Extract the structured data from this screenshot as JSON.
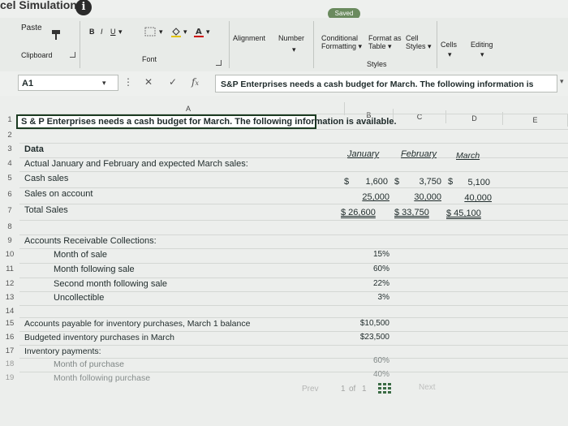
{
  "app": {
    "title": "cel Simulation",
    "saved": "Saved"
  },
  "ribbon": {
    "paste": "Paste",
    "font_buttons": [
      "B",
      "I",
      "U"
    ],
    "alignment": "Alignment",
    "number": "Number",
    "conditional_formatting_line1": "Conditional",
    "conditional_formatting_line2": "Formatting",
    "format_as_table_line1": "Format as",
    "format_as_table_line2": "Table",
    "cell_styles_line1": "Cell",
    "cell_styles_line2": "Styles",
    "cells": "Cells",
    "editing": "Editing",
    "groups": {
      "clipboard": "Clipboard",
      "font": "Font",
      "styles": "Styles"
    }
  },
  "formula_bar": {
    "cell_ref": "A1",
    "formula": "S&P Enterprises needs a cash budget for March. The following information is"
  },
  "columns": [
    "A",
    "B",
    "C",
    "D",
    "E"
  ],
  "rows": {
    "r1": "S & P Enterprises needs a cash budget for March. The following information is available.",
    "r3": {
      "label": "Data",
      "b": "January",
      "c": "February",
      "d": "March"
    },
    "r4": "Actual January and February and expected March sales:",
    "r5": {
      "label": "Cash sales",
      "b_cur": "$",
      "b": "1,600",
      "c_cur": "$",
      "c": "3,750",
      "d_cur": "$",
      "d": "5,100"
    },
    "r6": {
      "label": "Sales on account",
      "b": "25,000",
      "c": "30,000",
      "d": "40,000"
    },
    "r7": {
      "label": "Total Sales",
      "b": "$ 26,600",
      "c": "$ 33,750",
      "d": "$ 45,100"
    },
    "r9": "Accounts Receivable Collections:",
    "r10": {
      "label": "Month of sale",
      "b": "15%"
    },
    "r11": {
      "label": "Month following sale",
      "b": "60%"
    },
    "r12": {
      "label": "Second month following sale",
      "b": "22%"
    },
    "r13": {
      "label": "Uncollectible",
      "b": "3%"
    },
    "r15": {
      "label": "Accounts payable for inventory purchases, March 1 balance",
      "b": "$10,500"
    },
    "r16": {
      "label": "Budgeted inventory purchases in March",
      "b": "$23,500"
    },
    "r17": "Inventory payments:",
    "r18": {
      "label": "Month of purchase",
      "b": "60%"
    },
    "r19": {
      "label": "Month following purchase",
      "b": "40%"
    }
  },
  "pager": {
    "prev": "Prev",
    "page": "1",
    "of": "of",
    "total": "1",
    "next": "Next"
  }
}
